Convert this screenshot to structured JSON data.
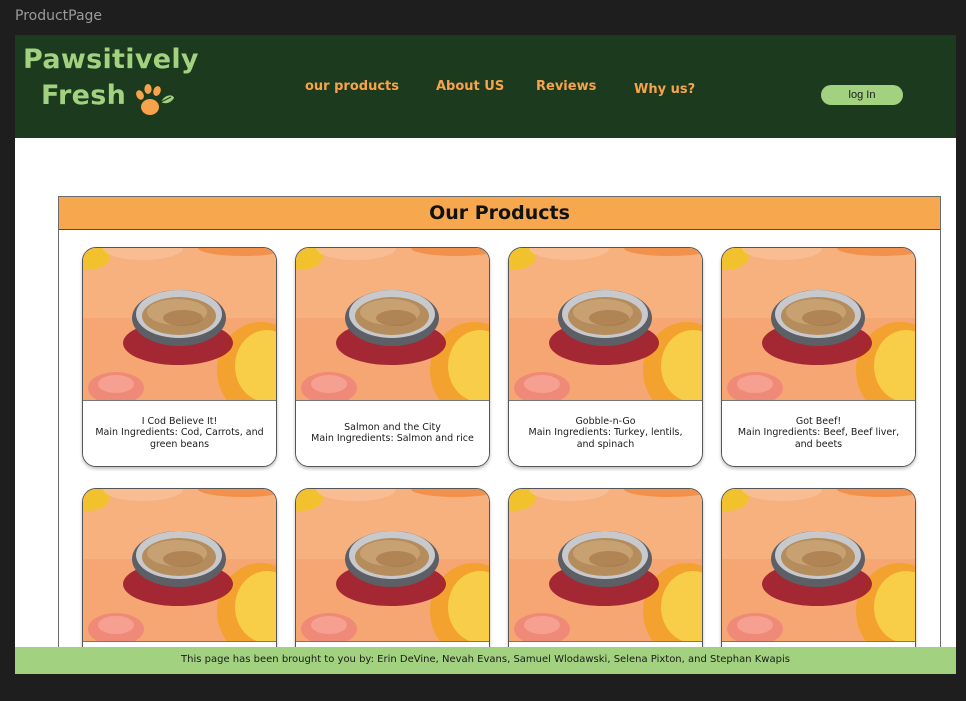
{
  "frame": {
    "label": "ProductPage"
  },
  "brand": {
    "line1": "Pawsitively",
    "line2": "Fresh",
    "logo_icon": "paw-leaf-icon",
    "colors": {
      "header_bg": "#1c3a1d",
      "logo_green": "#a2d180",
      "nav_orange": "#f7a34b"
    }
  },
  "nav": {
    "items": [
      {
        "label": "our products"
      },
      {
        "label": "About US"
      },
      {
        "label": "Reviews"
      },
      {
        "label": "Why us?"
      }
    ],
    "login_label": "log In"
  },
  "products": {
    "title": "Our Products",
    "title_bg": "#f7a84f",
    "cards": [
      {
        "name": "I Cod Believe It!",
        "ingredients": "Main Ingredients: Cod, Carrots, and green beans",
        "image": "food-bowl-image"
      },
      {
        "name": "Salmon and the City",
        "ingredients": "Main Ingredients: Salmon and rice",
        "image": "food-bowl-image"
      },
      {
        "name": "Gobble-n-Go",
        "ingredients": "Main Ingredients: Turkey, lentils, and spinach",
        "image": "food-bowl-image"
      },
      {
        "name": "Got Beef!",
        "ingredients": "Main Ingredients: Beef, Beef liver, and beets",
        "image": "food-bowl-image"
      },
      {
        "name": "",
        "ingredients": "",
        "image": "food-bowl-image"
      },
      {
        "name": "",
        "ingredients": "",
        "image": "food-bowl-image"
      },
      {
        "name": "",
        "ingredients": "",
        "image": "food-bowl-image"
      },
      {
        "name": "",
        "ingredients": "",
        "image": "food-bowl-image"
      }
    ]
  },
  "footer": {
    "text": "This page has been brought to you by: Erin DeVine, Nevah Evans, Samuel Wlodawski, Selena Pixton, and Stephan Kwapis",
    "bg": "#a2d180"
  }
}
